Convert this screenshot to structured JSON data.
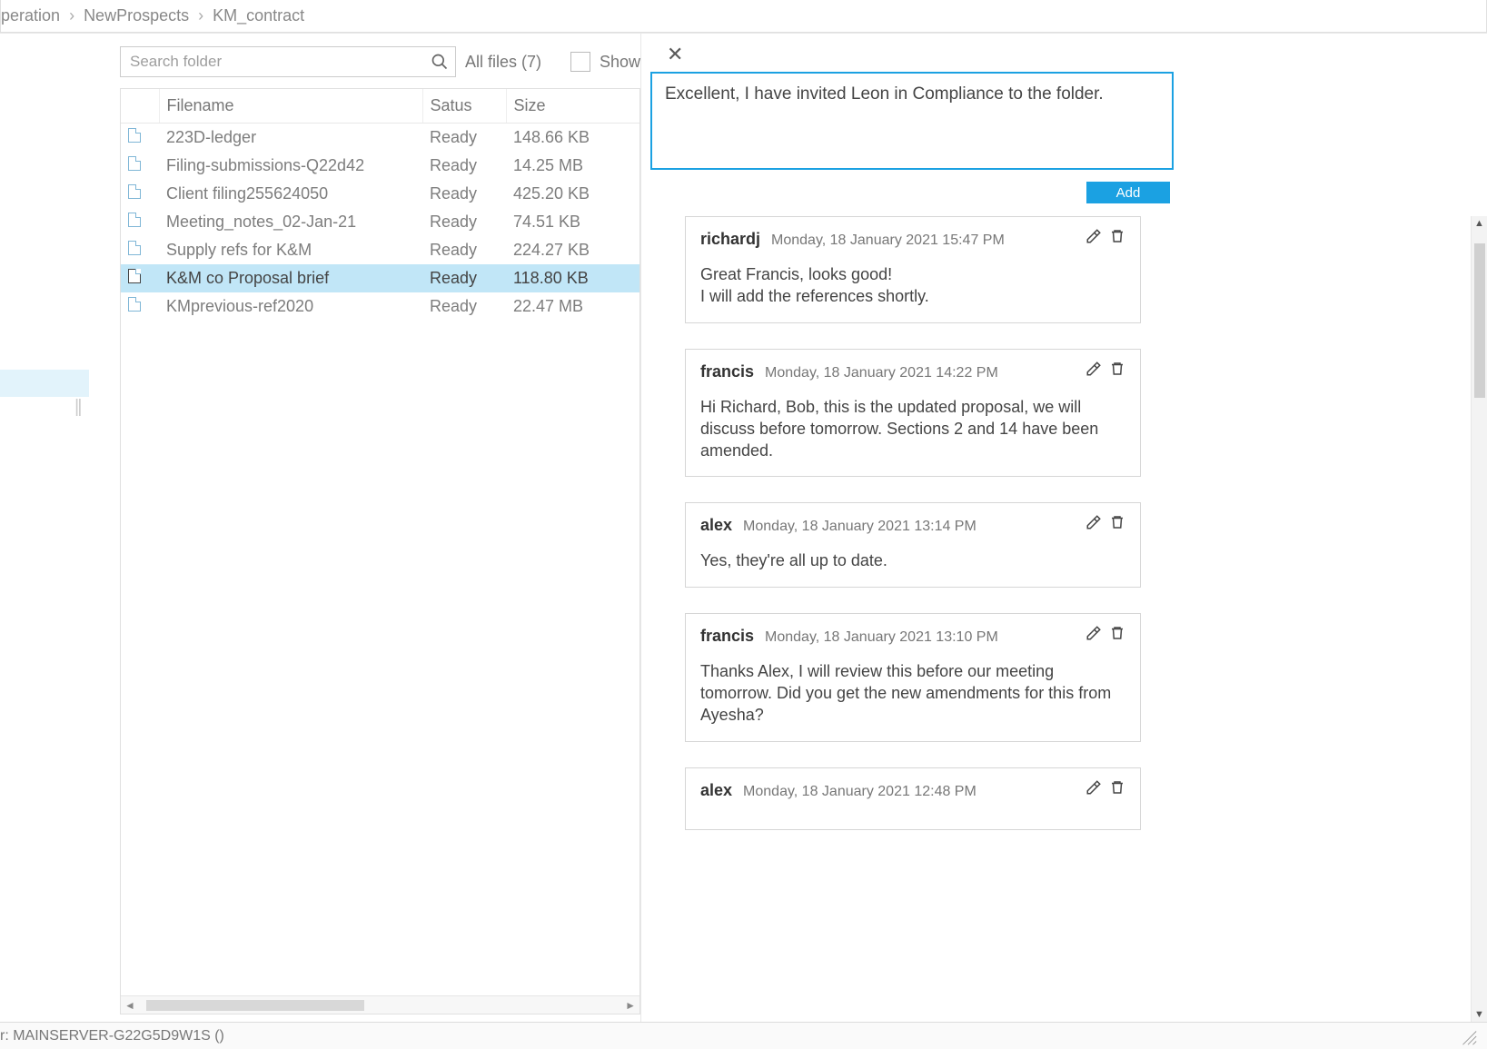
{
  "breadcrumb": [
    "peration",
    "NewProspects",
    "KM_contract"
  ],
  "toolbar": {
    "search_placeholder": "Search folder",
    "files_label": "All files (7)",
    "show_label": "Show"
  },
  "columns": {
    "icon": "",
    "name": "Filename",
    "status": "Satus",
    "size": "Size"
  },
  "files": [
    {
      "name": "223D-ledger",
      "status": "Ready",
      "size": "148.66 KB",
      "selected": false
    },
    {
      "name": "Filing-submissions-Q22d42",
      "status": "Ready",
      "size": "14.25 MB",
      "selected": false
    },
    {
      "name": "Client filing255624050",
      "status": "Ready",
      "size": "425.20 KB",
      "selected": false
    },
    {
      "name": "Meeting_notes_02-Jan-21",
      "status": "Ready",
      "size": "74.51 KB",
      "selected": false
    },
    {
      "name": "Supply refs for K&M",
      "status": "Ready",
      "size": "224.27 KB",
      "selected": false
    },
    {
      "name": "K&M co Proposal brief",
      "status": "Ready",
      "size": "118.80 KB",
      "selected": true
    },
    {
      "name": "KMprevious-ref2020",
      "status": "Ready",
      "size": "22.47 MB",
      "selected": false
    }
  ],
  "compose": {
    "value": "Excellent, I have invited Leon in Compliance to the folder.",
    "add_label": "Add"
  },
  "comments": [
    {
      "author": "richardj",
      "ts": "Monday, 18 January 2021 15:47 PM",
      "body": "Great Francis, looks good!\nI will add the references shortly."
    },
    {
      "author": "francis",
      "ts": "Monday, 18 January 2021 14:22 PM",
      "body": "Hi Richard, Bob, this is the updated proposal, we will discuss before tomorrow. Sections 2 and 14 have been amended."
    },
    {
      "author": "alex",
      "ts": "Monday, 18 January 2021 13:14 PM",
      "body": "Yes, they're all up to date."
    },
    {
      "author": "francis",
      "ts": "Monday, 18 January 2021 13:10 PM",
      "body": "Thanks Alex, I will review this before our meeting tomorrow. Did you get the new amendments for this from Ayesha?"
    },
    {
      "author": "alex",
      "ts": "Monday, 18 January 2021 12:48 PM",
      "body": ""
    }
  ],
  "status": {
    "text": "r: MAINSERVER-G22G5D9W1S ()"
  }
}
